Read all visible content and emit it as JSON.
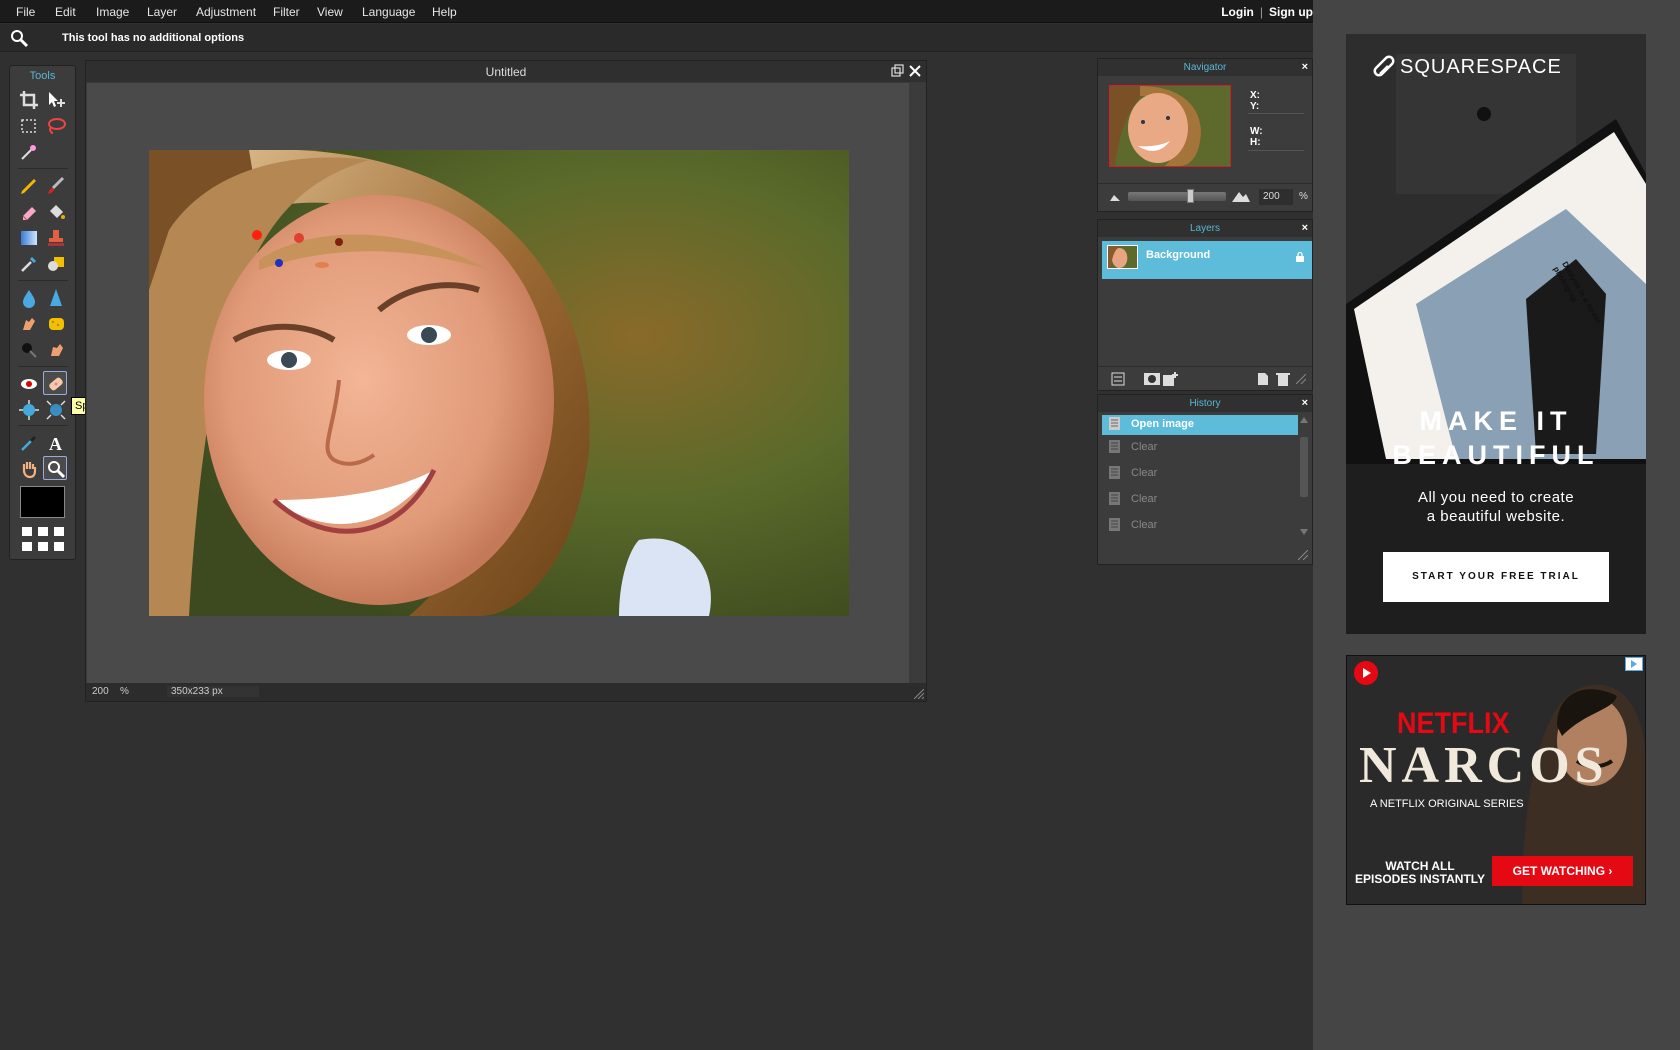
{
  "menubar": {
    "items": [
      "File",
      "Edit",
      "Image",
      "Layer",
      "Adjustment",
      "Filter",
      "View",
      "Language",
      "Help"
    ],
    "login": "Login",
    "separator": "|",
    "signup": "Sign up"
  },
  "options": {
    "tool_icon": "magnifier-icon",
    "message": "This tool has no additional options"
  },
  "tools": {
    "title": "Tools",
    "tooltip": "Spot heal tool",
    "foreground_color": "#000000"
  },
  "document": {
    "title": "Untitled",
    "zoom": "200",
    "zoom_unit": "%",
    "size": "350x233 px"
  },
  "navigator": {
    "title": "Navigator",
    "close": "×",
    "x_label": "X:",
    "y_label": "Y:",
    "w_label": "W:",
    "h_label": "H:",
    "zoom": "200",
    "zoom_unit": "%",
    "zoom_level": 0.66
  },
  "layers": {
    "title": "Layers",
    "close": "×",
    "items": [
      {
        "name": "Background",
        "locked": true
      }
    ]
  },
  "history": {
    "title": "History",
    "close": "×",
    "items": [
      {
        "label": "Open image",
        "active": true
      },
      {
        "label": "Clear",
        "active": false
      },
      {
        "label": "Clear",
        "active": false
      },
      {
        "label": "Clear",
        "active": false
      },
      {
        "label": "Clear",
        "active": false
      }
    ]
  },
  "ads": {
    "squarespace": {
      "brand": "SQUARESPACE",
      "headline_line1": "MAKE IT",
      "headline_line2": "BEAUTIFUL",
      "sub_line1": "All you need to create",
      "sub_line2": "a beautiful website.",
      "cta": "START YOUR FREE TRIAL",
      "tablet_text": "Dwayne is a street photograp"
    },
    "netflix": {
      "brand": "NETFLIX",
      "title": "NARCOS",
      "tagline": "A NETFLIX ORIGINAL SERIES",
      "watch_line1": "WATCH ALL",
      "watch_line2": "EPISODES INSTANTLY",
      "cta": "GET WATCHING",
      "cta_arrow": "›"
    }
  },
  "colors": {
    "accent": "#5cbcda",
    "panel_title": "#58b7d7",
    "netflix_red": "#e50914"
  }
}
